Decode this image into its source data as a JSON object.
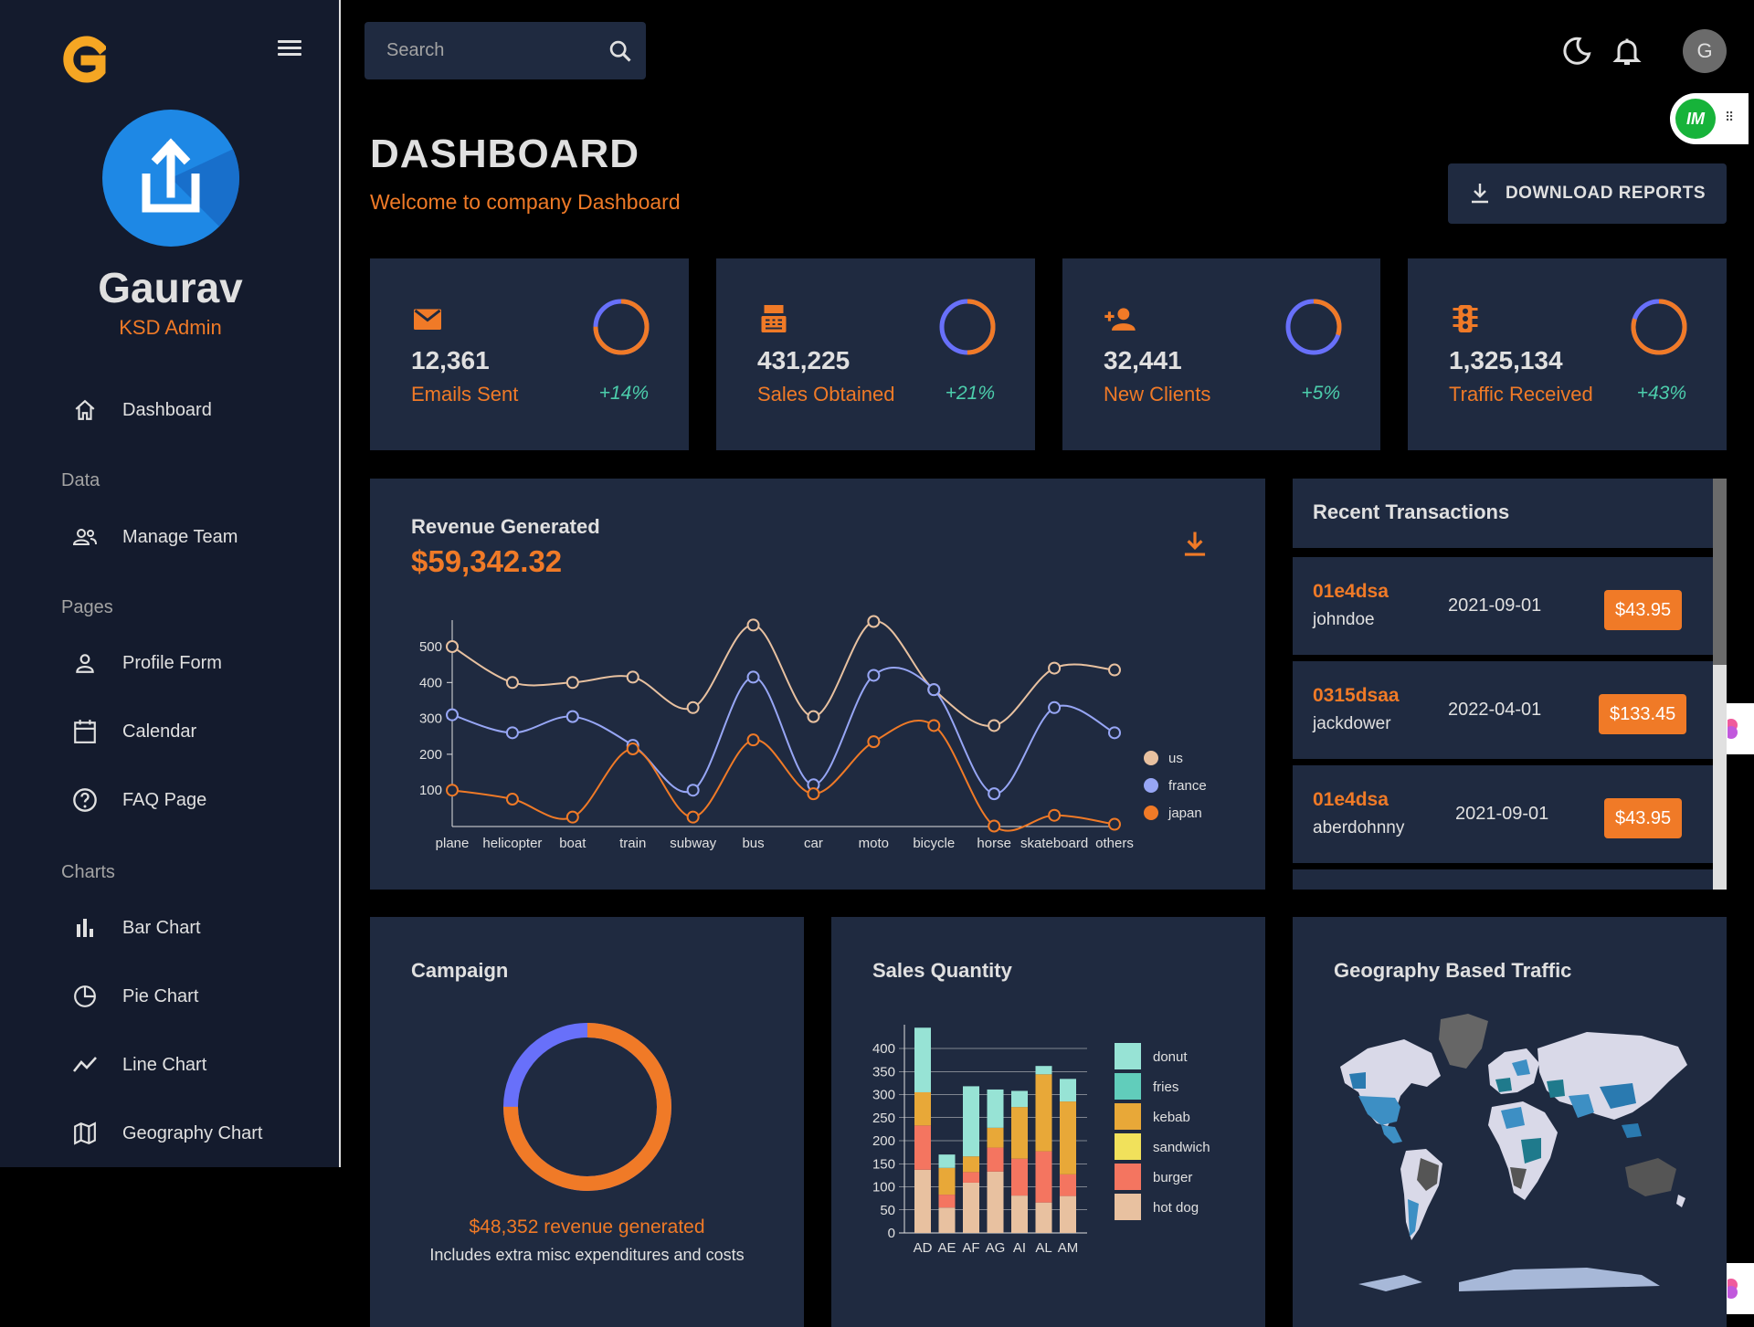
{
  "sidebar": {
    "brand_letter": "G",
    "user_name": "Gaurav",
    "user_role": "KSD Admin",
    "items": [
      {
        "label": "Dashboard",
        "icon": "home-icon"
      },
      {
        "label": "Manage Team",
        "icon": "people-icon"
      },
      {
        "label": "Profile Form",
        "icon": "person-icon"
      },
      {
        "label": "Calendar",
        "icon": "calendar-icon"
      },
      {
        "label": "FAQ Page",
        "icon": "help-icon"
      },
      {
        "label": "Bar Chart",
        "icon": "bar-chart-icon"
      },
      {
        "label": "Pie Chart",
        "icon": "pie-chart-icon"
      },
      {
        "label": "Line Chart",
        "icon": "line-chart-icon"
      },
      {
        "label": "Geography Chart",
        "icon": "map-icon"
      }
    ],
    "sections": {
      "data": "Data",
      "pages": "Pages",
      "charts": "Charts"
    }
  },
  "topbar": {
    "search_placeholder": "Search",
    "avatar_letter": "G",
    "extension_label": "IM"
  },
  "header": {
    "title": "DASHBOARD",
    "subtitle": "Welcome to company Dashboard",
    "download_label": "DOWNLOAD REPORTS"
  },
  "stats": [
    {
      "value": "12,361",
      "label": "Emails Sent",
      "increase": "+14%",
      "progress": 0.75,
      "icon": "email-icon"
    },
    {
      "value": "431,225",
      "label": "Sales Obtained",
      "increase": "+21%",
      "progress": 0.5,
      "icon": "point-of-sale-icon"
    },
    {
      "value": "32,441",
      "label": "New Clients",
      "increase": "+5%",
      "progress": 0.3,
      "icon": "person-add-icon"
    },
    {
      "value": "1,325,134",
      "label": "Traffic Received",
      "increase": "+43%",
      "progress": 0.8,
      "icon": "traffic-icon"
    }
  ],
  "revenue": {
    "title": "Revenue Generated",
    "amount": "$59,342.32"
  },
  "transactions": {
    "title": "Recent Transactions",
    "rows": [
      {
        "txId": "01e4dsa",
        "user": "johndoe",
        "date": "2021-09-01",
        "cost": "$43.95"
      },
      {
        "txId": "0315dsaa",
        "user": "jackdower",
        "date": "2022-04-01",
        "cost": "$133.45"
      },
      {
        "txId": "01e4dsa",
        "user": "aberdohnny",
        "date": "2021-09-01",
        "cost": "$43.95"
      }
    ]
  },
  "campaign": {
    "title": "Campaign",
    "revenue_text": "$48,352 revenue generated",
    "note": "Includes extra misc expenditures and costs",
    "progress": 0.75
  },
  "sales_quantity": {
    "title": "Sales Quantity"
  },
  "geography": {
    "title": "Geography Based Traffic"
  },
  "colors": {
    "accent": "#f07a27",
    "panel": "#1f2a40",
    "sidebar": "#141b2d",
    "green": "#4cceac",
    "blue": "#6870fa"
  },
  "chart_data": [
    {
      "type": "line",
      "categories": [
        "plane",
        "helicopter",
        "boat",
        "train",
        "subway",
        "bus",
        "car",
        "moto",
        "bicycle",
        "horse",
        "skateboard",
        "others"
      ],
      "ylim": [
        0,
        600
      ],
      "yticks": [
        100,
        200,
        300,
        400,
        500
      ],
      "series": [
        {
          "name": "us",
          "color": "#e8c1a0",
          "values": [
            500,
            400,
            400,
            415,
            330,
            560,
            305,
            570,
            380,
            280,
            440,
            435
          ]
        },
        {
          "name": "france",
          "color": "#97a6f5",
          "values": [
            310,
            260,
            305,
            225,
            100,
            415,
            115,
            420,
            380,
            90,
            330,
            260
          ]
        },
        {
          "name": "japan",
          "color": "#f07a27",
          "values": [
            100,
            75,
            25,
            215,
            25,
            240,
            90,
            235,
            280,
            0,
            30,
            5
          ]
        }
      ],
      "legend": "right"
    },
    {
      "type": "bar",
      "stacked": true,
      "categories": [
        "AD",
        "AE",
        "AF",
        "AG",
        "AI",
        "AL",
        "AM"
      ],
      "ylim": [
        0,
        450
      ],
      "yticks": [
        0,
        50,
        100,
        150,
        200,
        250,
        300,
        350,
        400
      ],
      "series": [
        {
          "name": "hot dog",
          "color": "#e8c1a0",
          "values": [
            137,
            55,
            109,
            133,
            81,
            66,
            80
          ]
        },
        {
          "name": "burger",
          "color": "#f47560",
          "values": [
            96,
            28,
            23,
            52,
            80,
            111,
            47
          ]
        },
        {
          "name": "sandwich",
          "color": "#f1e15b",
          "values": [
            0,
            0,
            0,
            0,
            0,
            0,
            0
          ]
        },
        {
          "name": "kebab",
          "color": "#e8a838",
          "values": [
            72,
            58,
            34,
            43,
            112,
            167,
            158
          ]
        },
        {
          "name": "fries",
          "color": "#61cdbb",
          "values": [
            0,
            0,
            0,
            0,
            0,
            0,
            0
          ]
        },
        {
          "name": "donut",
          "color": "#97e3d5",
          "values": [
            140,
            29,
            152,
            83,
            35,
            18,
            49
          ]
        }
      ],
      "legend_order": [
        "donut",
        "fries",
        "kebab",
        "sandwich",
        "burger",
        "hot dog"
      ],
      "legend": "right"
    },
    {
      "type": "pie",
      "title": "Campaign",
      "values": [
        0.75,
        0.25
      ],
      "colors": [
        "#f07a27",
        "#6870fa"
      ]
    }
  ]
}
